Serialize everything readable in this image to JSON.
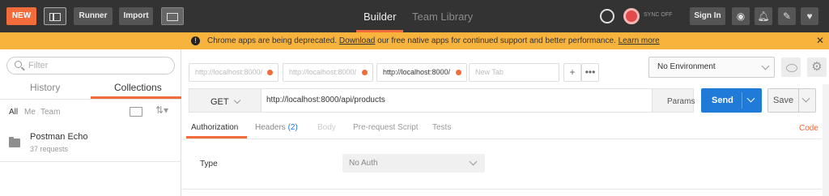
{
  "topbar": {
    "new_label": "NEW",
    "runner_label": "Runner",
    "import_label": "Import",
    "builder_tab": "Builder",
    "team_library_tab": "Team Library",
    "sync_label": "SYNC OFF",
    "signin_label": "Sign In"
  },
  "banner": {
    "prefix": "Chrome apps are being deprecated. ",
    "download_link": "Download",
    "middle": " our free native apps for continued support and better performance. ",
    "learn_more_link": "Learn more"
  },
  "sidebar": {
    "filter_placeholder": "Filter",
    "tabs": [
      "History",
      "Collections"
    ],
    "filters": [
      "All",
      "Me",
      "Team"
    ],
    "collection": {
      "name": "Postman Echo",
      "sub": "37 requests"
    }
  },
  "request_tabs": [
    {
      "label": "http://localhost:8000/"
    },
    {
      "label": "http://localhost:8000/"
    },
    {
      "label": "http://localhost:8000/"
    },
    {
      "label": "New Tab"
    }
  ],
  "environment": {
    "selected": "No Environment"
  },
  "request": {
    "method": "GET",
    "url": "http://localhost:8000/api/products",
    "params_label": "Params",
    "send_label": "Send",
    "save_label": "Save"
  },
  "panel_tabs": {
    "authorization": "Authorization",
    "headers": "Headers",
    "headers_count": "(2)",
    "body": "Body",
    "prerequest": "Pre-request Script",
    "tests": "Tests",
    "code": "Code"
  },
  "auth": {
    "type_label": "Type",
    "type_value": "No Auth"
  },
  "colors": {
    "accent": "#f26b3a",
    "primary": "#1f7ad8",
    "banner": "#f8b33c",
    "topbar": "#333333"
  }
}
